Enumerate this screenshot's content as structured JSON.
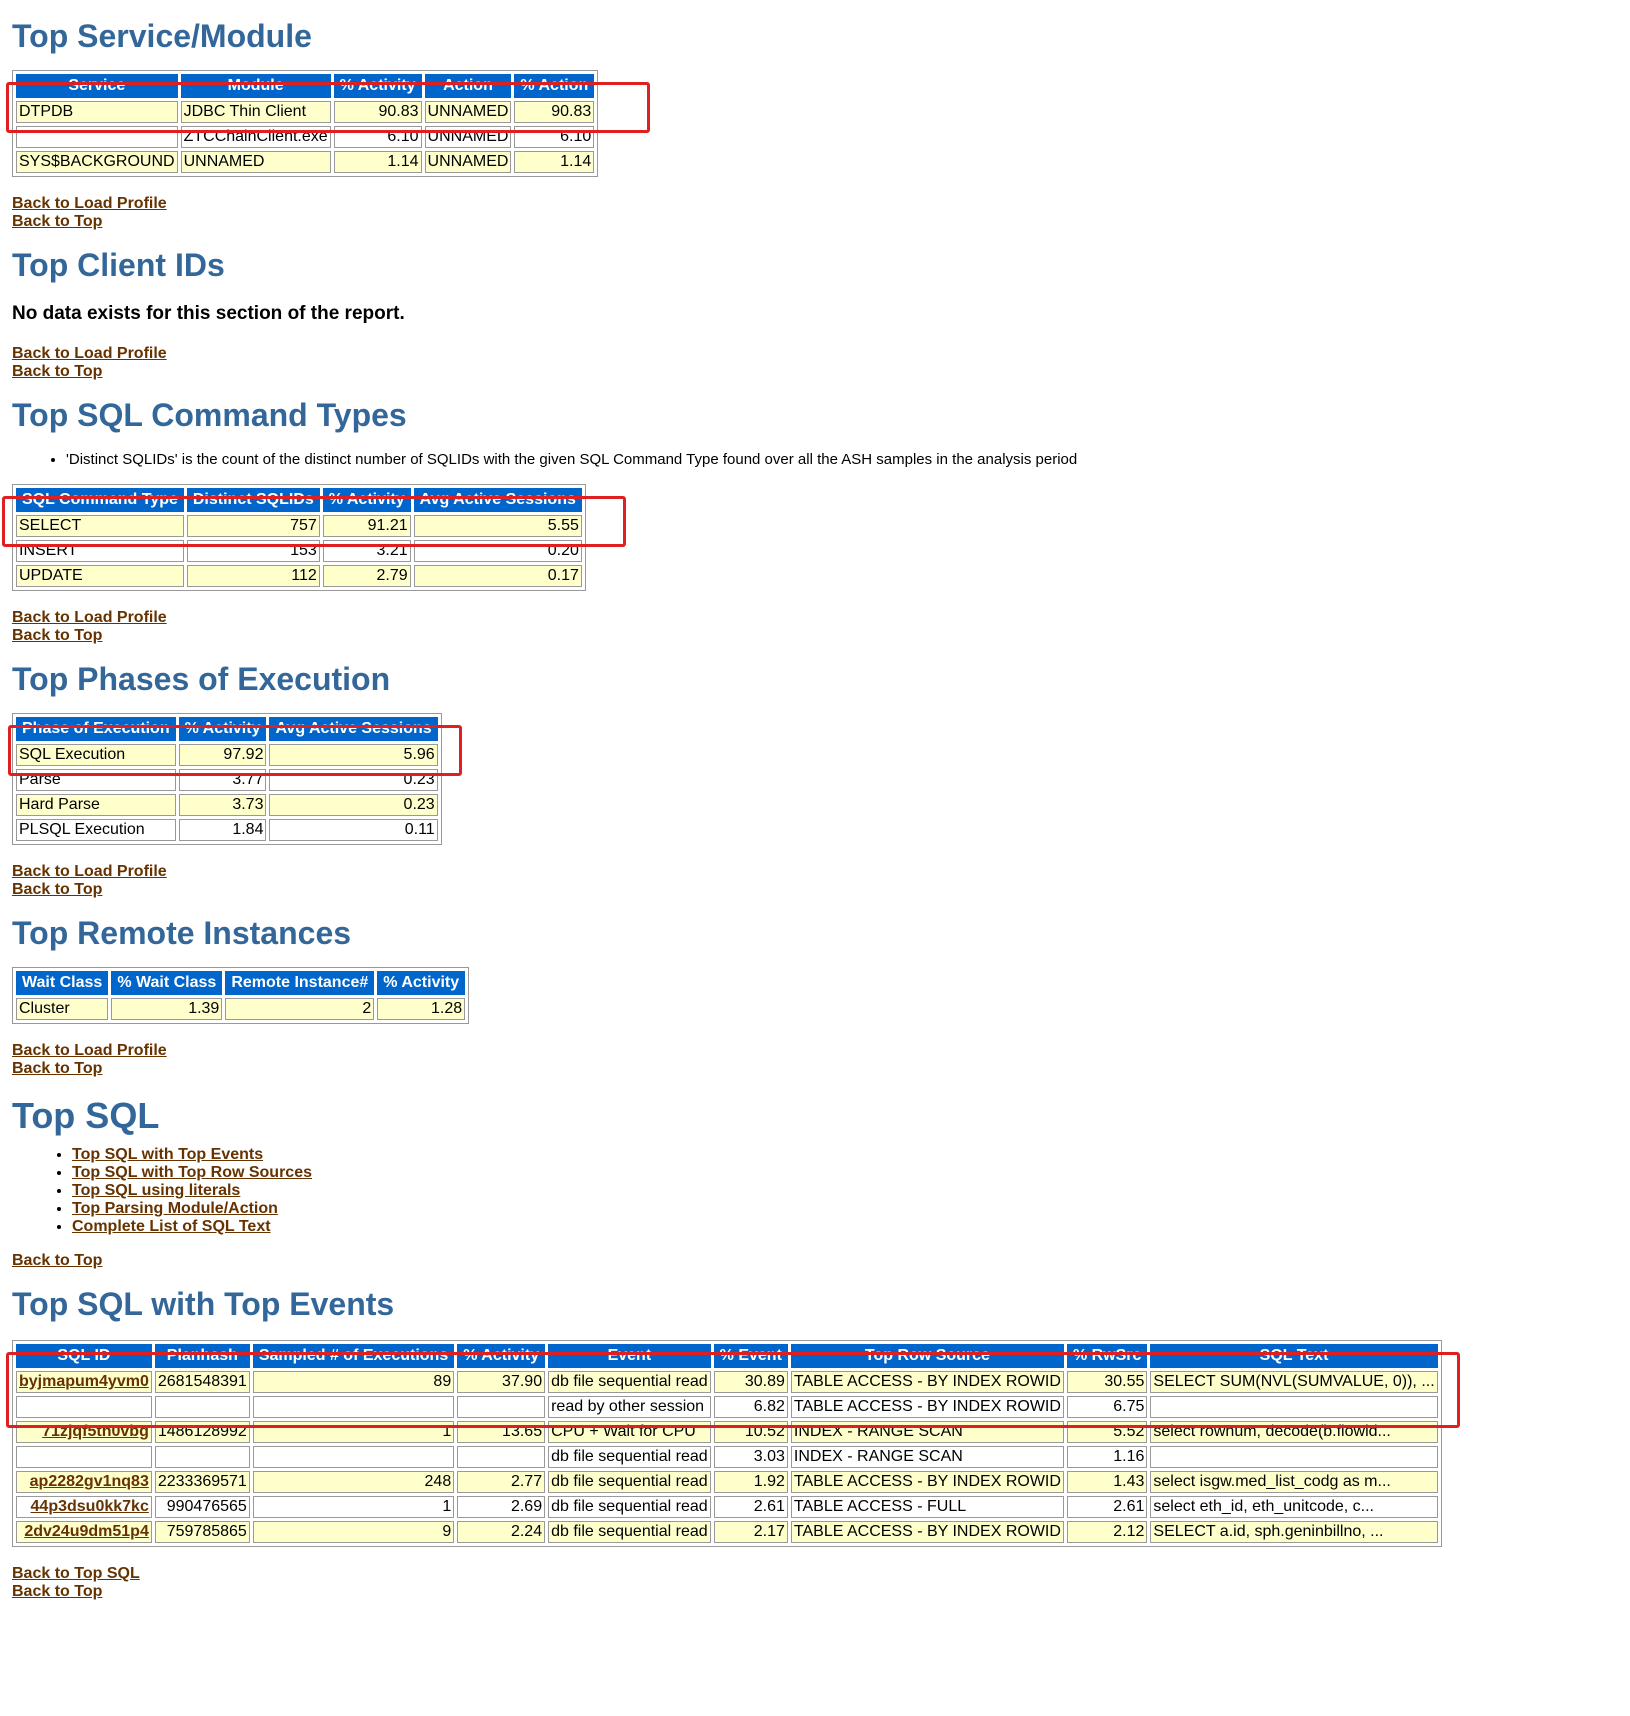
{
  "links": {
    "back_to_load_profile": "Back to Load Profile",
    "back_to_top": "Back to Top",
    "back_to_top_sql": "Back to Top SQL"
  },
  "service_module": {
    "title": "Top Service/Module",
    "headers": [
      "Service",
      "Module",
      "% Activity",
      "Action",
      "% Action"
    ],
    "rows": [
      [
        "DTPDB",
        "JDBC Thin Client",
        "90.83",
        "UNNAMED",
        "90.83"
      ],
      [
        "",
        "ZTCChainClient.exe",
        "6.10",
        "UNNAMED",
        "6.10"
      ],
      [
        "SYS$BACKGROUND",
        "UNNAMED",
        "1.14",
        "UNNAMED",
        "1.14"
      ]
    ]
  },
  "client_ids": {
    "title": "Top Client IDs",
    "message": "No data exists for this section of the report."
  },
  "command_types": {
    "title": "Top SQL Command Types",
    "note": "'Distinct SQLIDs' is the count of the distinct number of SQLIDs with the given SQL Command Type found over all the ASH samples in the analysis period",
    "headers": [
      "SQL Command Type",
      "Distinct SQLIDs",
      "% Activity",
      "Avg Active Sessions"
    ],
    "rows": [
      [
        "SELECT",
        "757",
        "91.21",
        "5.55"
      ],
      [
        "INSERT",
        "153",
        "3.21",
        "0.20"
      ],
      [
        "UPDATE",
        "112",
        "2.79",
        "0.17"
      ]
    ]
  },
  "phases": {
    "title": "Top Phases of Execution",
    "headers": [
      "Phase of Execution",
      "% Activity",
      "Avg Active Sessions"
    ],
    "rows": [
      [
        "SQL Execution",
        "97.92",
        "5.96"
      ],
      [
        "Parse",
        "3.77",
        "0.23"
      ],
      [
        "Hard Parse",
        "3.73",
        "0.23"
      ],
      [
        "PLSQL Execution",
        "1.84",
        "0.11"
      ]
    ]
  },
  "remote": {
    "title": "Top Remote Instances",
    "headers": [
      "Wait Class",
      "% Wait Class",
      "Remote Instance#",
      "% Activity"
    ],
    "rows": [
      [
        "Cluster",
        "1.39",
        "2",
        "1.28"
      ]
    ]
  },
  "top_sql": {
    "title": "Top SQL",
    "items": [
      "Top SQL with Top Events",
      "Top SQL with Top Row Sources",
      "Top SQL using literals",
      "Top Parsing Module/Action",
      "Complete List of SQL Text"
    ]
  },
  "sql_events": {
    "title": "Top SQL with Top Events",
    "headers": [
      "SQL ID",
      "Planhash",
      "Sampled # of Executions",
      "% Activity",
      "Event",
      "% Event",
      "Top Row Source",
      "% RwSrc",
      "SQL Text"
    ],
    "rows": [
      [
        "byjmapum4yvm0",
        "2681548391",
        "89",
        "37.90",
        "db file sequential read",
        "30.89",
        "TABLE ACCESS - BY INDEX ROWID",
        "30.55",
        "SELECT SUM(NVL(SUMVALUE, 0)), ..."
      ],
      [
        "",
        "",
        "",
        "",
        "read by other session",
        "6.82",
        "TABLE ACCESS - BY INDEX ROWID",
        "6.75",
        ""
      ],
      [
        "71zjqf5tn0vbg",
        "1486128992",
        "1",
        "13.65",
        "CPU + Wait for CPU",
        "10.52",
        "INDEX - RANGE SCAN",
        "5.52",
        "select rownum, decode(b.flowid..."
      ],
      [
        "",
        "",
        "",
        "",
        "db file sequential read",
        "3.03",
        "INDEX - RANGE SCAN",
        "1.16",
        ""
      ],
      [
        "ap2282gv1nq83",
        "2233369571",
        "248",
        "2.77",
        "db file sequential read",
        "1.92",
        "TABLE ACCESS - BY INDEX ROWID",
        "1.43",
        "select isgw.med_list_codg as m..."
      ],
      [
        "44p3dsu0kk7kc",
        "990476565",
        "1",
        "2.69",
        "db file sequential read",
        "2.61",
        "TABLE ACCESS - FULL",
        "2.61",
        "select eth_id, eth_unitcode, c..."
      ],
      [
        "2dv24u9dm51p4",
        "759785865",
        "9",
        "2.24",
        "db file sequential read",
        "2.17",
        "TABLE ACCESS - BY INDEX ROWID",
        "2.12",
        "SELECT a.id, sph.geninbillno, ..."
      ]
    ]
  },
  "colors": {
    "heading": "#336699",
    "header_bg": "#0066cc",
    "row_odd": "#ffffcc",
    "link": "#663300",
    "highlight": "#e02020"
  }
}
